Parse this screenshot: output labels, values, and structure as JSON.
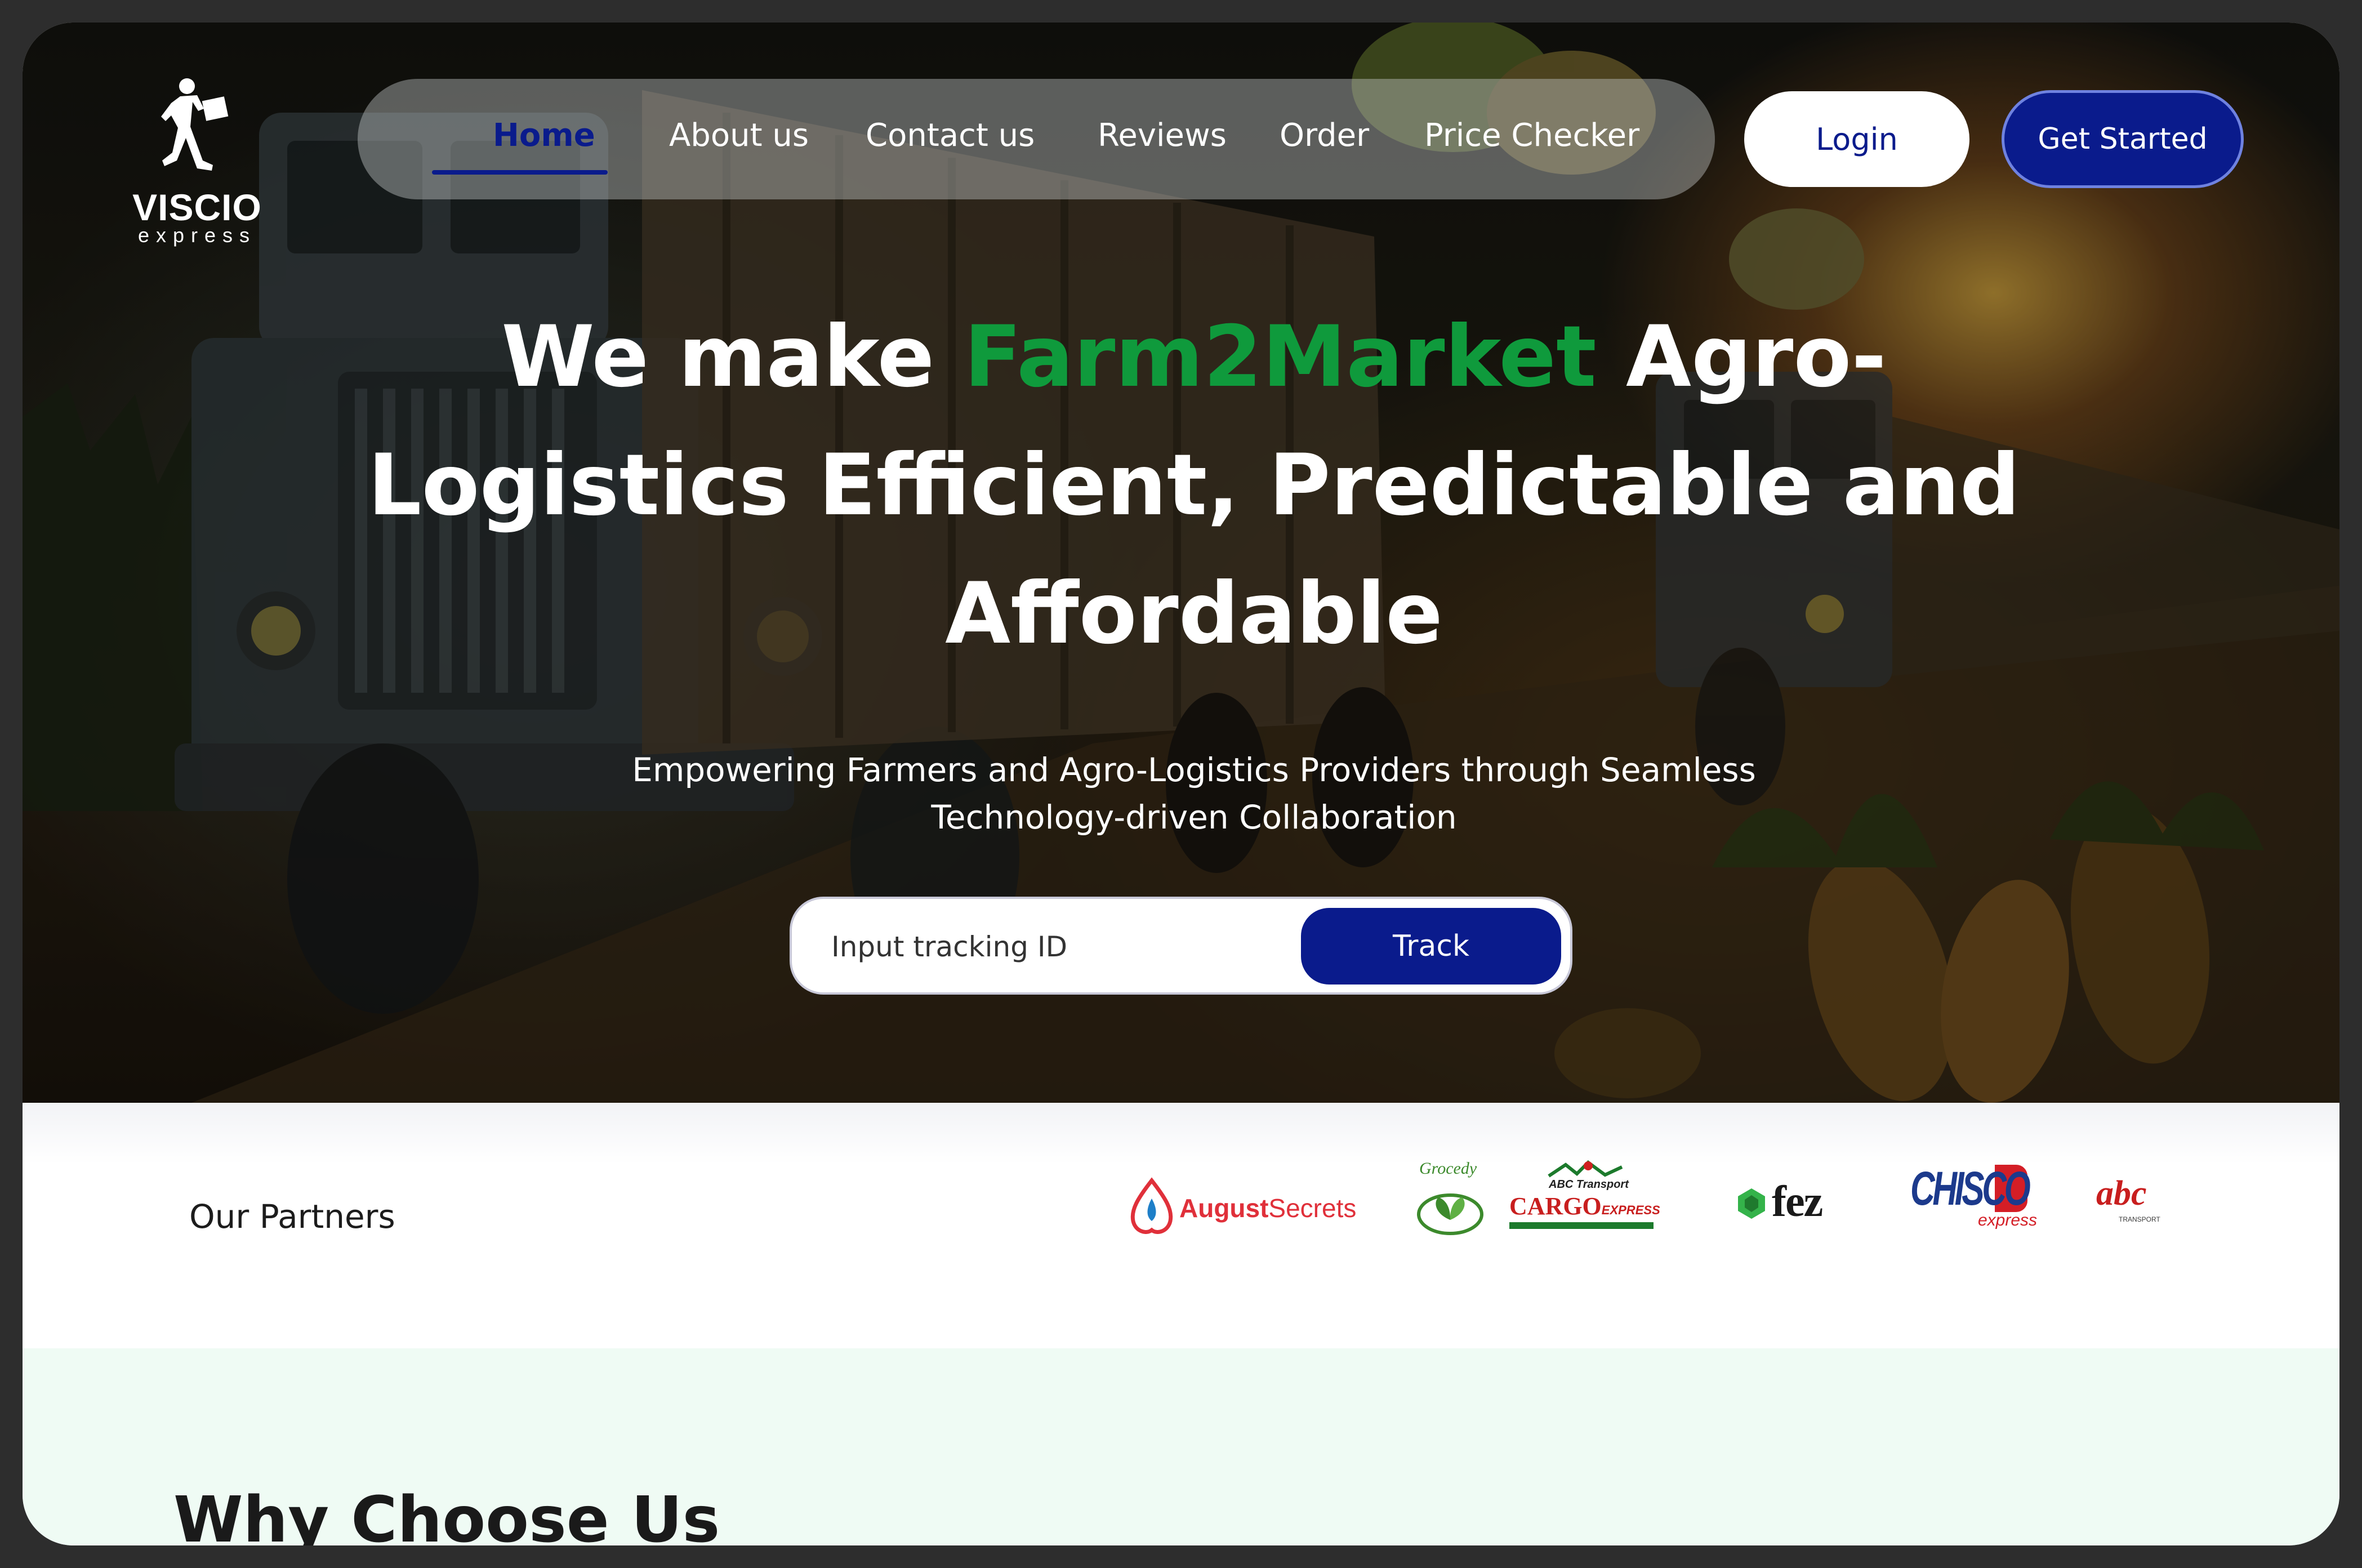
{
  "brand": {
    "name": "VISCIO",
    "tagline": "express"
  },
  "nav": {
    "items": [
      {
        "label": "Home",
        "active": true
      },
      {
        "label": "About us"
      },
      {
        "label": "Contact us"
      },
      {
        "label": "Reviews"
      },
      {
        "label": "Order"
      },
      {
        "label": "Price Checker"
      }
    ],
    "login_label": "Login",
    "get_started_label": "Get Started"
  },
  "hero": {
    "headline_pre": "We make ",
    "headline_highlight": "Farm2Market",
    "headline_post_1": " Agro-",
    "headline_line2": "Logistics Efficient, Predictable and",
    "headline_line3": "Affordable",
    "subheadline_line1": "Empowering Farmers and Agro-Logistics Providers through Seamless",
    "subheadline_line2": "Technology-driven Collaboration",
    "track_placeholder": "Input tracking ID",
    "track_button": "Track"
  },
  "partners": {
    "title": "Our Partners",
    "logos": [
      {
        "name": "AugustSecrets",
        "part1": "August",
        "part2": "Secrets"
      },
      {
        "name": "Grocedy",
        "text": "Grocedy"
      },
      {
        "name": "ABC Transport Cargo Express",
        "top": "ABC Transport",
        "main": "CARGO",
        "suffix": "EXPRESS"
      },
      {
        "name": "fez",
        "text": "fez"
      },
      {
        "name": "Chisco Express",
        "main": "CHISCO",
        "sub": "express"
      },
      {
        "name": "abc transport",
        "text": "abc",
        "sub": "TRANSPORT"
      }
    ]
  },
  "why": {
    "title": "Why Choose Us"
  },
  "colors": {
    "primary": "#0a1b8c",
    "accent_green": "#0f9a3c",
    "why_bg": "#effbf4"
  }
}
